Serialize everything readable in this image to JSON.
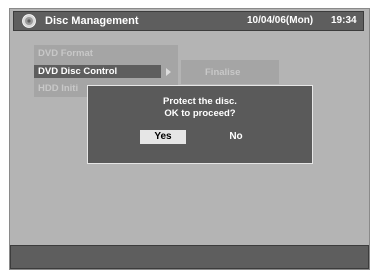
{
  "header": {
    "icon": "disc-icon",
    "title": "Disc Management",
    "date": "10/04/06(Mon)",
    "time": "19:34"
  },
  "menu": {
    "items": [
      {
        "label": "DVD Format",
        "selected": false
      },
      {
        "label": "DVD Disc Control",
        "selected": true
      },
      {
        "label": "HDD Initi",
        "selected": false
      }
    ]
  },
  "submenu": {
    "items": [
      {
        "label": "Finalise"
      }
    ]
  },
  "dialog": {
    "line1": "Protect the disc.",
    "line2": "OK to proceed?",
    "yes_label": "Yes",
    "no_label": "No",
    "selected": "Yes"
  },
  "colors": {
    "background": "#b4b4b4",
    "bar": "#5e5e5e",
    "dialog": "#5a5a5a",
    "highlight": "#e6e6e6"
  }
}
